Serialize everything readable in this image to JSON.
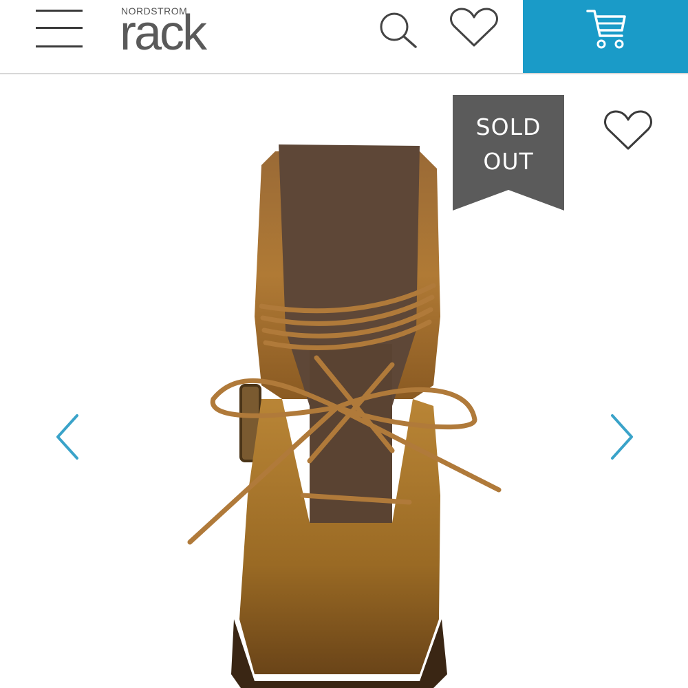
{
  "header": {
    "brand_top": "NORDSTROM",
    "brand_main": "rack",
    "menu_icon": "hamburger-menu-icon",
    "search_icon": "search-icon",
    "wishlist_icon": "heart-icon",
    "cart_icon": "shopping-cart-icon",
    "cart_color": "#1a9bc8"
  },
  "product": {
    "badge_line1": "SOLD",
    "badge_line2": "OUT",
    "badge_color": "#5b5b5b",
    "favorite_icon": "heart-icon",
    "prev_icon": "chevron-left-icon",
    "next_icon": "chevron-right-icon",
    "arrow_color": "#3aa3c9"
  }
}
